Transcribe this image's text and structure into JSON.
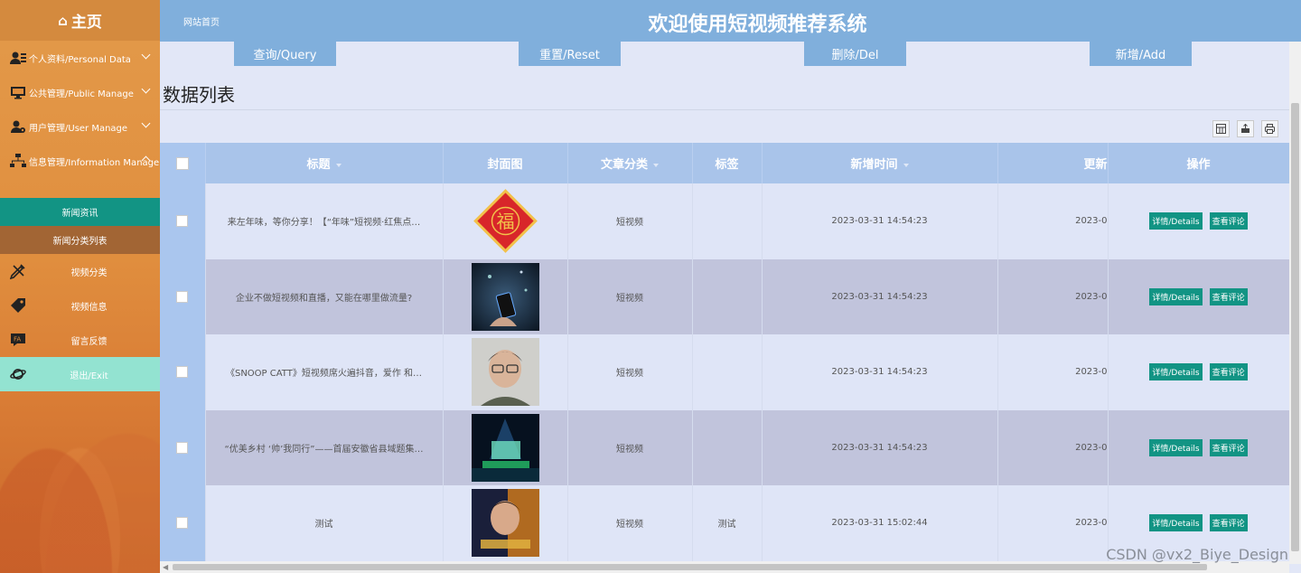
{
  "sidebar": {
    "home": "主页",
    "items": [
      {
        "label": "个人资料/Personal Data",
        "icon": "user-card-icon"
      },
      {
        "label": "公共管理/Public Manage",
        "icon": "monitor-icon"
      },
      {
        "label": "用户管理/User Manage",
        "icon": "user-gear-icon"
      },
      {
        "label": "信息管理/Information Manage",
        "icon": "sitemap-icon"
      }
    ],
    "sub_items": [
      "新闻资讯",
      "新闻分类列表"
    ],
    "items2": [
      {
        "label": "视频分类",
        "icon": "pencil-ruler-icon"
      },
      {
        "label": "视频信息",
        "icon": "tag-icon"
      },
      {
        "label": "留言反馈",
        "icon": "message-icon"
      },
      {
        "label": "退出/Exit",
        "icon": "planet-icon"
      }
    ]
  },
  "header": {
    "breadcrumb": "网站首页",
    "title": "欢迎使用短视频推荐系统"
  },
  "toolbar": {
    "query": "查询/Query",
    "reset": "重置/Reset",
    "delete": "删除/Del",
    "add": "新增/Add"
  },
  "list_title": "数据列表",
  "table": {
    "headers": [
      "标题",
      "封面图",
      "文章分类",
      "标签",
      "新增时间",
      "更新",
      "操作"
    ],
    "rows": [
      {
        "title": "来左年味，等你分享！【“年味”短视频·红焦点…",
        "category": "短视频",
        "tag": "",
        "created": "2023-03-31 14:54:23",
        "updated": "2023-0",
        "cover": "fu"
      },
      {
        "title": "企业不做短视频和直播，又能在哪里做流量?",
        "category": "短视频",
        "tag": "",
        "created": "2023-03-31 14:54:23",
        "updated": "2023-0",
        "cover": "phone"
      },
      {
        "title": "《SNOOP CATT》短视频席火遍抖音，爱作 和…",
        "category": "短视频",
        "tag": "",
        "created": "2023-03-31 14:54:23",
        "updated": "2023-0",
        "cover": "face"
      },
      {
        "title": "“优美乡村 ‘帅’我同行”——首届安徽省县域题集…",
        "category": "短视频",
        "tag": "",
        "created": "2023-03-31 14:54:23",
        "updated": "2023-0",
        "cover": "stage"
      },
      {
        "title": "测试",
        "category": "短视频",
        "tag": "测试",
        "created": "2023-03-31 15:02:44",
        "updated": "2023-0",
        "cover": "poster"
      }
    ],
    "op_details": "详情/Details",
    "op_comments": "查看评论"
  },
  "watermark": "CSDN @vx2_Biye_Design",
  "colors": {
    "header": "#80afdc",
    "sidebar": "#e08e3e",
    "accent": "#129484",
    "exit": "#93e3d1"
  }
}
